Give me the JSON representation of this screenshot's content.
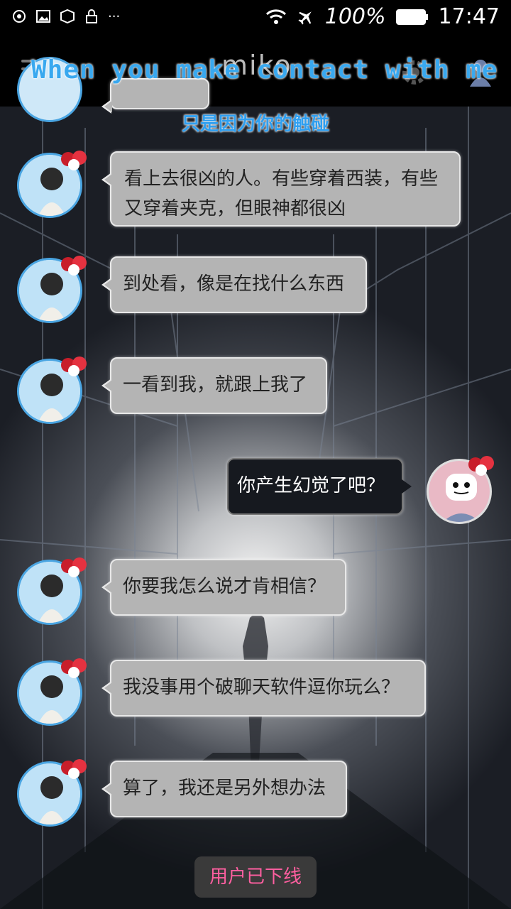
{
  "status_bar": {
    "battery": "100%",
    "time": "17:47"
  },
  "header": {
    "app_name": "miko",
    "lyric_en": "When you make contact with me",
    "lyric_cn": "只是因为你的触碰"
  },
  "messages": [
    {
      "side": "in",
      "text": "看上去很凶的人。有些穿着西装，有些又穿着夹克，但眼神都很凶"
    },
    {
      "side": "in",
      "text": "到处看，像是在找什么东西"
    },
    {
      "side": "in",
      "text": "一看到我，就跟上我了"
    },
    {
      "side": "out",
      "text": "你产生幻觉了吧？"
    },
    {
      "side": "in",
      "text": "你要我怎么说才肯相信？"
    },
    {
      "side": "in",
      "text": "我没事用个破聊天软件逗你玩么？"
    },
    {
      "side": "in",
      "text": "算了，我还是另外想办法"
    }
  ],
  "footer": {
    "offline_notice": "用户已下线"
  },
  "colors": {
    "lyric": "#39a8ef",
    "avatar_border": "#4aa5e2",
    "offline_text": "#ff5fa0"
  },
  "icons": [
    "menu-icon",
    "gear-icon",
    "user-icon",
    "wifi-icon",
    "airplane-icon",
    "battery-icon"
  ]
}
